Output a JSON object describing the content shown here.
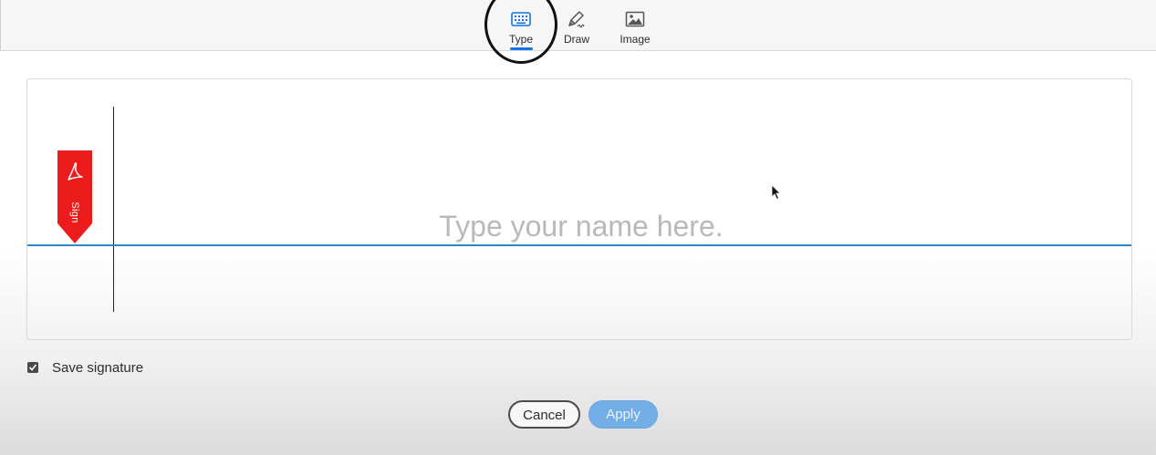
{
  "tabs": [
    {
      "label": "Type",
      "icon": "keyboard-icon",
      "active": true
    },
    {
      "label": "Draw",
      "icon": "pen-icon",
      "active": false
    },
    {
      "label": "Image",
      "icon": "image-icon",
      "active": false
    }
  ],
  "signature": {
    "badge_text": "Sign",
    "badge_icon": "acrobat-logo-icon",
    "name_value": "",
    "name_placeholder": "Type your name here."
  },
  "save": {
    "label": "Save signature",
    "checked": true
  },
  "buttons": {
    "cancel_label": "Cancel",
    "apply_label": "Apply"
  },
  "colors": {
    "accent": "#1473e6",
    "baseline": "#2f86c8",
    "sign_badge": "#ec1c1c",
    "apply_disabled": "#74aee6"
  }
}
